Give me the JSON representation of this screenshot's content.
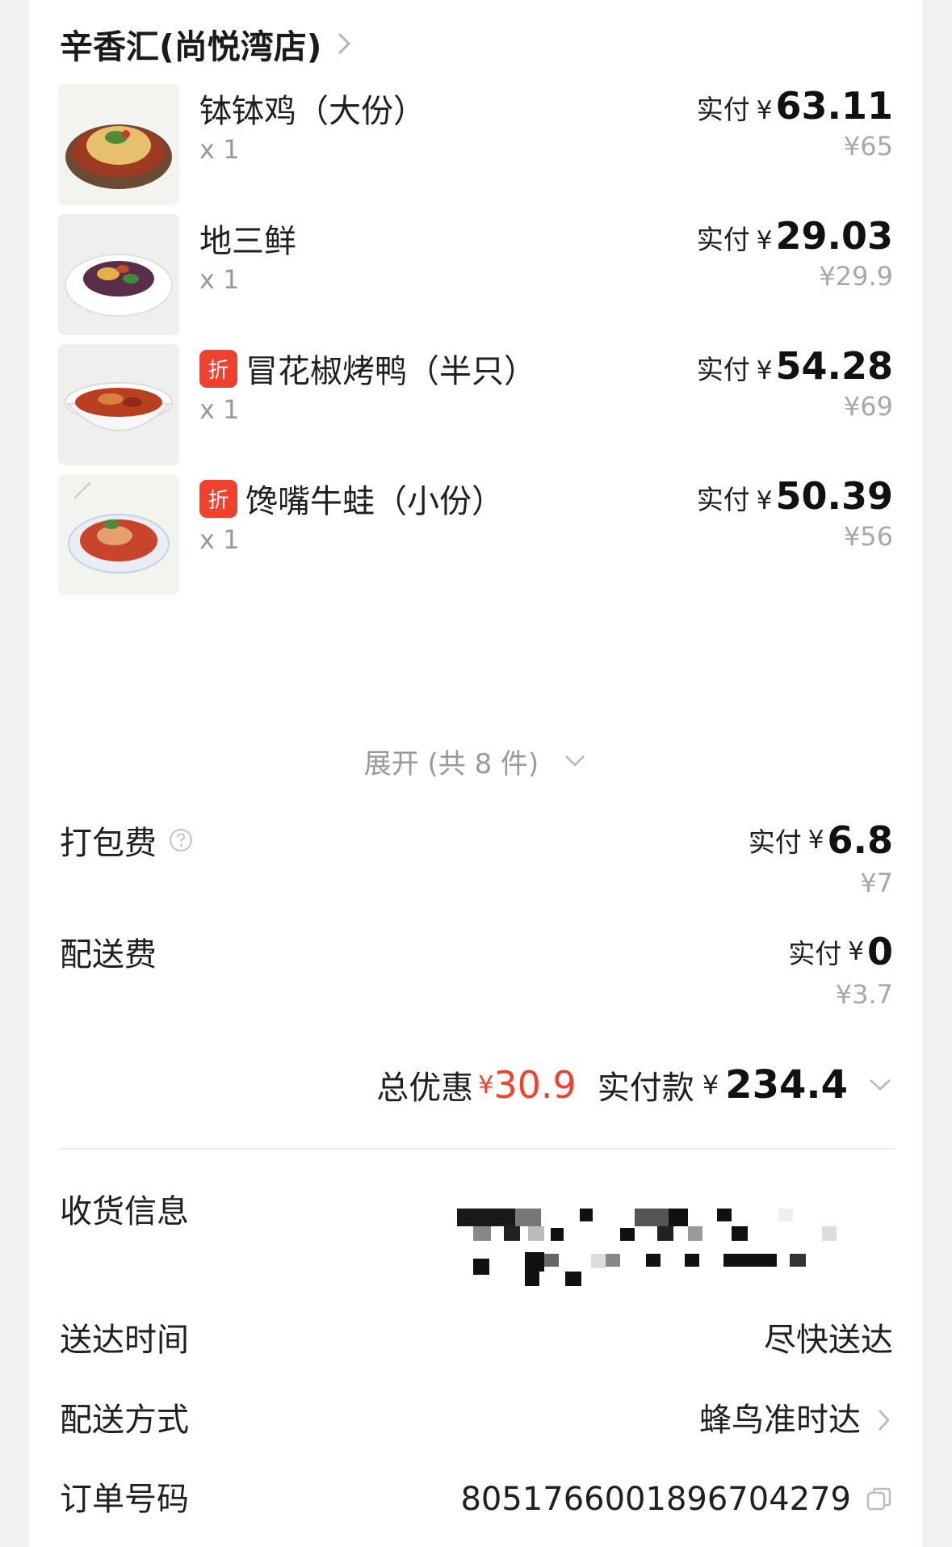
{
  "store": {
    "name": "辛香汇(尚悦湾店)"
  },
  "items": [
    {
      "name": "钵钵鸡（大份）",
      "qty": "x 1",
      "paid_label": "实付",
      "yen": "¥",
      "paid": "63.11",
      "original": "¥65",
      "discount_badge": ""
    },
    {
      "name": "地三鲜",
      "qty": "x 1",
      "paid_label": "实付",
      "yen": "¥",
      "paid": "29.03",
      "original": "¥29.9",
      "discount_badge": ""
    },
    {
      "name": "冒花椒烤鸭（半只）",
      "qty": "x 1",
      "paid_label": "实付",
      "yen": "¥",
      "paid": "54.28",
      "original": "¥69",
      "discount_badge": "折"
    },
    {
      "name": "馋嘴牛蛙（小份）",
      "qty": "x 1",
      "paid_label": "实付",
      "yen": "¥",
      "paid": "50.39",
      "original": "¥56",
      "discount_badge": "折"
    }
  ],
  "expand": {
    "label": "展开 (共 8 件)"
  },
  "fees": [
    {
      "label": "打包费",
      "paid_label": "实付",
      "yen": "¥",
      "paid": "6.8",
      "original": "¥7",
      "has_help": true
    },
    {
      "label": "配送费",
      "paid_label": "实付",
      "yen": "¥",
      "paid": "0",
      "original": "¥3.7",
      "has_help": false
    }
  ],
  "summary": {
    "discount_label": "总优惠",
    "discount_yen": "¥",
    "discount_value": "30.9",
    "pay_label": "实付款",
    "pay_yen": "¥",
    "pay_value": "234.4"
  },
  "info": {
    "address_label": "收货信息",
    "time_label": "送达时间",
    "time_value": "尽快送达",
    "delivery_label": "配送方式",
    "delivery_value": "蜂鸟准时达",
    "order_label": "订单号码",
    "order_value": "8051766001896704279"
  },
  "icons": {
    "store_chevron": "chevron-right-icon",
    "help": "question-circle-icon",
    "expand": "chevron-down-icon",
    "summary": "chevron-down-icon",
    "delivery_chevron": "chevron-right-icon",
    "copy": "copy-icon"
  },
  "colors": {
    "accent_red": "#f0412f",
    "muted_text": "#a8a8a8"
  }
}
